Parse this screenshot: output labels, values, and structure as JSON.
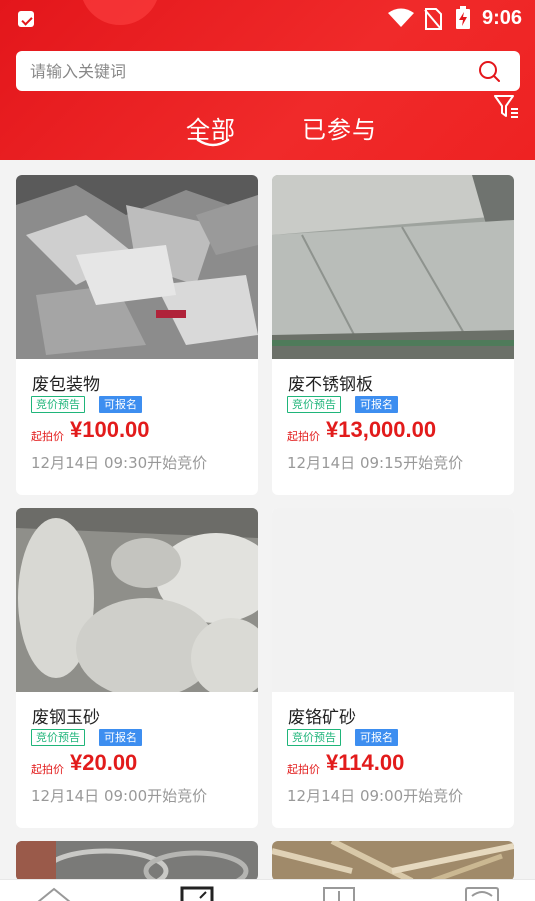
{
  "status_bar": {
    "time": "9:06"
  },
  "search": {
    "placeholder": "请输入关键词"
  },
  "tabs": [
    {
      "label": "全部",
      "active": true
    },
    {
      "label": "已参与",
      "active": false
    }
  ],
  "colors": {
    "brand_red": "#e3161b",
    "preview_green": "#1fb57a",
    "signup_blue": "#3d8ef0"
  },
  "cards": [
    {
      "title": "废包装物",
      "badge_preview": "竞价预告",
      "badge_signup": "可报名",
      "price_label": "起拍价",
      "price": "¥100.00",
      "time": "12月14日 09:30开始竞价",
      "image": "scrap-packaging-photo"
    },
    {
      "title": "废不锈钢板",
      "badge_preview": "竞价预告",
      "badge_signup": "可报名",
      "price_label": "起拍价",
      "price": "¥13,000.00",
      "time": "12月14日 09:15开始竞价",
      "image": "stainless-steel-plate-photo"
    },
    {
      "title": "废钢玉砂",
      "badge_preview": "竞价预告",
      "badge_signup": "可报名",
      "price_label": "起拍价",
      "price": "¥20.00",
      "time": "12月14日 09:00开始竞价",
      "image": "corundum-sand-sacks-photo"
    },
    {
      "title": "废铬矿砂",
      "badge_preview": "竞价预告",
      "badge_signup": "可报名",
      "price_label": "起拍价",
      "price": "¥114.00",
      "time": "12月14日 09:00开始竞价",
      "image": "placeholder-blank"
    }
  ],
  "bottom_nav": [
    "home-icon",
    "bid-icon",
    "download-icon",
    "message-icon"
  ]
}
